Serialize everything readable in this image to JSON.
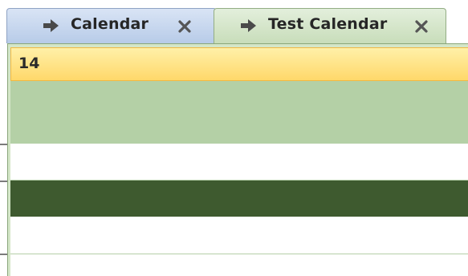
{
  "tabs": [
    {
      "label": "Calendar",
      "icon": "arrow-right-icon",
      "close": "close-icon"
    },
    {
      "label": "Test Calendar",
      "icon": "arrow-right-icon",
      "close": "close-icon"
    }
  ],
  "day": {
    "number": "14"
  },
  "colors": {
    "calendar_tab": "#b7cbe8",
    "test_tab": "#c8ddba",
    "header": "#ffd86a",
    "allday": "#b4d0a6",
    "event": "#3e5a2f"
  }
}
